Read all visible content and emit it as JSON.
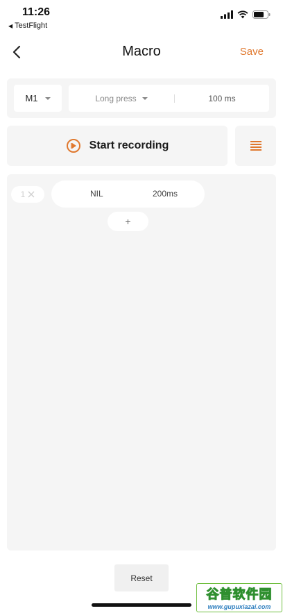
{
  "status_bar": {
    "time": "11:26",
    "back_app": "TestFlight"
  },
  "nav": {
    "title": "Macro",
    "save_label": "Save"
  },
  "config": {
    "key": "M1",
    "mode": "Long press",
    "duration": "100 ms"
  },
  "record": {
    "label": "Start recording"
  },
  "steps": {
    "repeat_label": "1",
    "items": [
      {
        "key": "NIL",
        "duration": "200ms"
      }
    ],
    "add_label": "+"
  },
  "footer": {
    "reset_label": "Reset"
  },
  "watermark": {
    "top": "谷普软件园",
    "bottom": "www.gupuxiazai.com"
  },
  "colors": {
    "accent": "#e0782e",
    "panel": "#f5f5f5",
    "text": "#1a1a1a"
  },
  "icons": {
    "back": "chevron-left-icon",
    "record": "play-circle-icon",
    "list": "list-icon",
    "remove": "close-icon",
    "dropdown": "caret-down-icon"
  }
}
